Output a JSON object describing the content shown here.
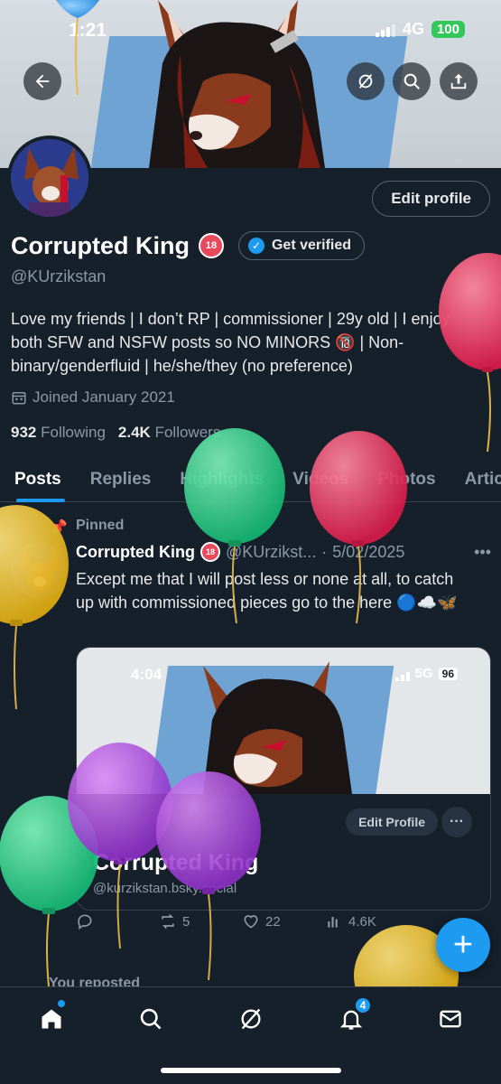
{
  "status": {
    "time": "1:21",
    "network": "4G",
    "battery": "100"
  },
  "header": {
    "back_icon": "arrow-left-icon",
    "actions": [
      "grok-icon",
      "search-icon",
      "share-icon"
    ]
  },
  "profile": {
    "edit_label": "Edit profile",
    "display_name": "Corrupted King",
    "age_badge": "18",
    "get_verified_label": "Get verified",
    "handle": "@KUrzikstan",
    "bio": "Love my friends | I don’t RP | commissioner | 29y old | I enjoy both SFW and NSFW posts so NO MINORS 🔞 | Non-binary/genderfluid | he/she/they (no preference)",
    "joined": "Joined January 2021",
    "following_count": "932",
    "following_label": "Following",
    "followers_count": "2.4K",
    "followers_label": "Followers"
  },
  "tabs": [
    "Posts",
    "Replies",
    "Highlights",
    "Videos",
    "Photos",
    "Artic"
  ],
  "post": {
    "pinned_label": "Pinned",
    "name": "Corrupted King",
    "handle": "@KUrzikst...",
    "date": "5/02/2025",
    "text": "Except me that I will post less or none at all, to catch up with commissioned pieces go to the here 🔵☁️🦋",
    "embed": {
      "time": "4:04",
      "network": "5G",
      "battery": "96",
      "edit_label": "Edit Profile",
      "name": "Corrupted King",
      "handle": "@kurzikstan.bsky.social"
    },
    "actions": {
      "reposts": "5",
      "likes": "22",
      "views": "4.6K"
    }
  },
  "next_item": {
    "label": "You reposted"
  },
  "fab_label": "+",
  "nav": {
    "notifications_badge": "4"
  },
  "colors": {
    "background": "#15202b",
    "accent": "#1d9bf0",
    "muted": "#8b98a5"
  }
}
